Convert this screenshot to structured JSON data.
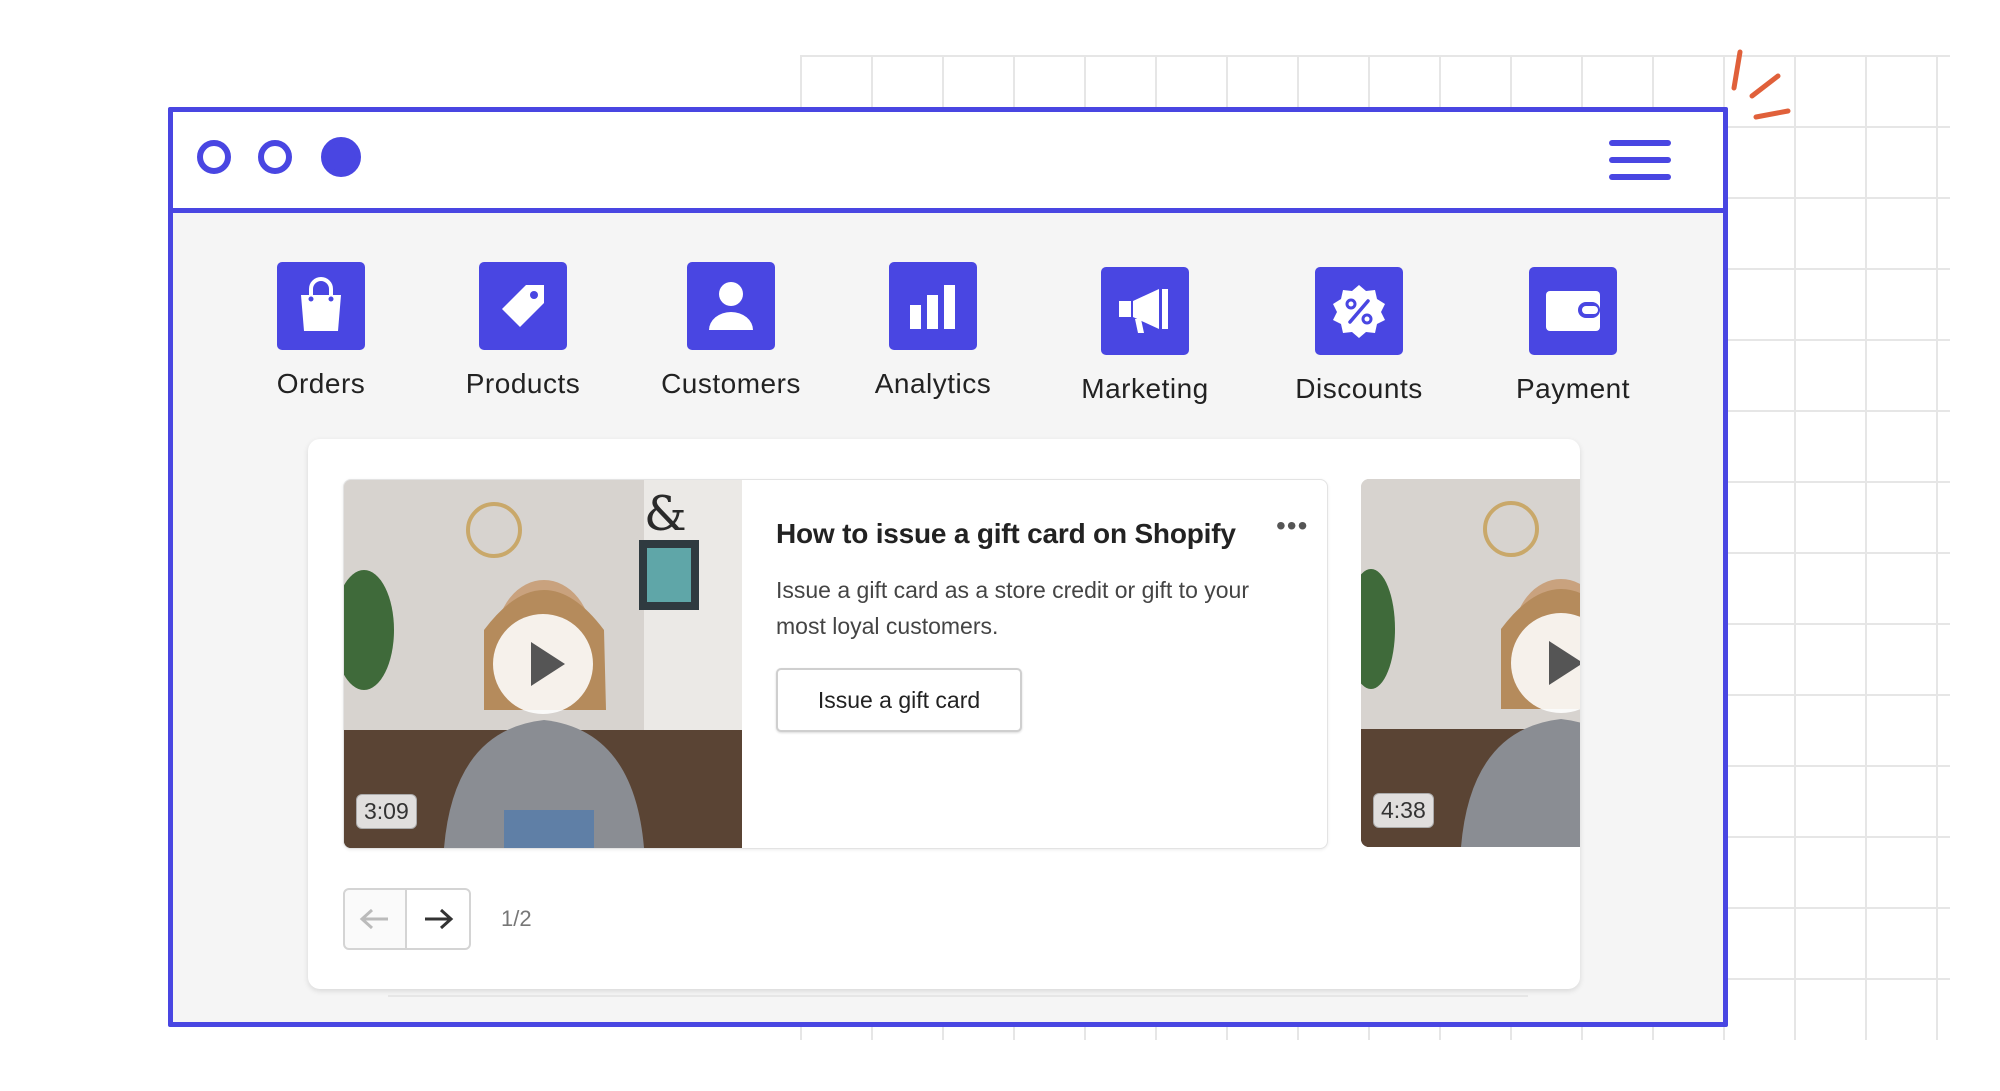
{
  "nav": {
    "items": [
      {
        "label": "Orders",
        "icon": "shopping-bag-icon"
      },
      {
        "label": "Products",
        "icon": "tag-icon"
      },
      {
        "label": "Customers",
        "icon": "person-icon"
      },
      {
        "label": "Analytics",
        "icon": "bar-chart-icon"
      },
      {
        "label": "Marketing",
        "icon": "megaphone-icon"
      },
      {
        "label": "Discounts",
        "icon": "discount-badge-icon"
      },
      {
        "label": "Payment",
        "icon": "wallet-icon"
      }
    ]
  },
  "video_card": {
    "title": "How to issue a gift card on Shopify",
    "description": "Issue a gift card as a store credit or gift to your most loyal customers.",
    "button_label": "Issue a gift card",
    "duration": "3:09",
    "more_label": "•••"
  },
  "next_video": {
    "duration": "4:38"
  },
  "pager": {
    "page": "1/2",
    "prev_icon": "arrow-left-icon",
    "next_icon": "arrow-right-icon"
  },
  "colors": {
    "accent": "#4946e2",
    "spark": "#e0603a"
  }
}
